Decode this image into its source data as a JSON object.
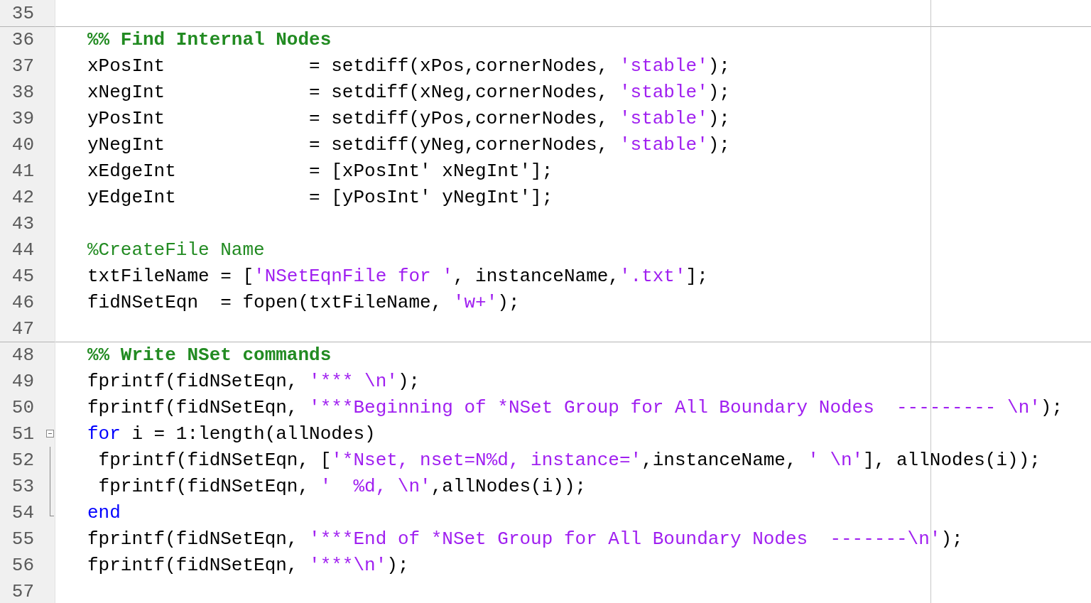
{
  "editor": {
    "lines": [
      {
        "number": "35"
      },
      {
        "number": "36",
        "section_start": true,
        "tokens": [
          {
            "kind": "section",
            "text": "%% Find Internal Nodes"
          }
        ]
      },
      {
        "number": "37",
        "tokens": [
          {
            "kind": "code",
            "text": "xPosInt             = setdiff(xPos,cornerNodes, "
          },
          {
            "kind": "string",
            "text": "'stable'"
          },
          {
            "kind": "code",
            "text": ");"
          }
        ]
      },
      {
        "number": "38",
        "tokens": [
          {
            "kind": "code",
            "text": "xNegInt             = setdiff(xNeg,cornerNodes, "
          },
          {
            "kind": "string",
            "text": "'stable'"
          },
          {
            "kind": "code",
            "text": ");"
          }
        ]
      },
      {
        "number": "39",
        "tokens": [
          {
            "kind": "code",
            "text": "yPosInt             = setdiff(yPos,cornerNodes, "
          },
          {
            "kind": "string",
            "text": "'stable'"
          },
          {
            "kind": "code",
            "text": ");"
          }
        ]
      },
      {
        "number": "40",
        "tokens": [
          {
            "kind": "code",
            "text": "yNegInt             = setdiff(yNeg,cornerNodes, "
          },
          {
            "kind": "string",
            "text": "'stable'"
          },
          {
            "kind": "code",
            "text": ");"
          }
        ]
      },
      {
        "number": "41",
        "tokens": [
          {
            "kind": "code",
            "text": "xEdgeInt            = [xPosInt' xNegInt'];"
          }
        ]
      },
      {
        "number": "42",
        "tokens": [
          {
            "kind": "code",
            "text": "yEdgeInt            = [yPosInt' yNegInt'];"
          }
        ]
      },
      {
        "number": "43"
      },
      {
        "number": "44",
        "tokens": [
          {
            "kind": "comment",
            "text": "%CreateFile Name"
          }
        ]
      },
      {
        "number": "45",
        "tokens": [
          {
            "kind": "code",
            "text": "txtFileName = ["
          },
          {
            "kind": "string",
            "text": "'NSetEqnFile for '"
          },
          {
            "kind": "code",
            "text": ", instanceName,"
          },
          {
            "kind": "string",
            "text": "'.txt'"
          },
          {
            "kind": "code",
            "text": "];"
          }
        ]
      },
      {
        "number": "46",
        "tokens": [
          {
            "kind": "code",
            "text": "fidNSetEqn  = fopen(txtFileName, "
          },
          {
            "kind": "string",
            "text": "'w+'"
          },
          {
            "kind": "code",
            "text": ");"
          }
        ]
      },
      {
        "number": "47"
      },
      {
        "number": "48",
        "section_start": true,
        "tokens": [
          {
            "kind": "section",
            "text": "%% Write NSet commands"
          }
        ]
      },
      {
        "number": "49",
        "tokens": [
          {
            "kind": "code",
            "text": "fprintf(fidNSetEqn, "
          },
          {
            "kind": "string",
            "text": "'*** \\n'"
          },
          {
            "kind": "code",
            "text": ");"
          }
        ]
      },
      {
        "number": "50",
        "tokens": [
          {
            "kind": "code",
            "text": "fprintf(fidNSetEqn, "
          },
          {
            "kind": "string",
            "text": "'***Beginning of *NSet Group for All Boundary Nodes  --------- \\n'"
          },
          {
            "kind": "code",
            "text": ");"
          }
        ]
      },
      {
        "number": "51",
        "kind": "fold_start",
        "expanded": true,
        "tokens": [
          {
            "kind": "keyword",
            "text": "for"
          },
          {
            "kind": "code",
            "text": " i = 1:length(allNodes)"
          }
        ]
      },
      {
        "number": "52",
        "kind": "fold_body",
        "tokens": [
          {
            "kind": "code",
            "text": " fprintf(fidNSetEqn, ["
          },
          {
            "kind": "string",
            "text": "'*Nset, nset=N%d, instance='"
          },
          {
            "kind": "code",
            "text": ",instanceName, "
          },
          {
            "kind": "string",
            "text": "' \\n'"
          },
          {
            "kind": "code",
            "text": "], allNodes(i));"
          }
        ]
      },
      {
        "number": "53",
        "kind": "fold_body",
        "tokens": [
          {
            "kind": "code",
            "text": " fprintf(fidNSetEqn, "
          },
          {
            "kind": "string",
            "text": "'  %d, \\n'"
          },
          {
            "kind": "code",
            "text": ",allNodes(i));"
          }
        ]
      },
      {
        "number": "54",
        "kind": "fold_end",
        "tokens": [
          {
            "kind": "keyword",
            "text": "end"
          }
        ]
      },
      {
        "number": "55",
        "tokens": [
          {
            "kind": "code",
            "text": "fprintf(fidNSetEqn, "
          },
          {
            "kind": "string",
            "text": "'***End of *NSet Group for All Boundary Nodes  -------\\n'"
          },
          {
            "kind": "code",
            "text": ");"
          }
        ]
      },
      {
        "number": "56",
        "tokens": [
          {
            "kind": "code",
            "text": "fprintf(fidNSetEqn, "
          },
          {
            "kind": "string",
            "text": "'***\\n'"
          },
          {
            "kind": "code",
            "text": ");"
          }
        ]
      },
      {
        "number": "57"
      }
    ]
  }
}
